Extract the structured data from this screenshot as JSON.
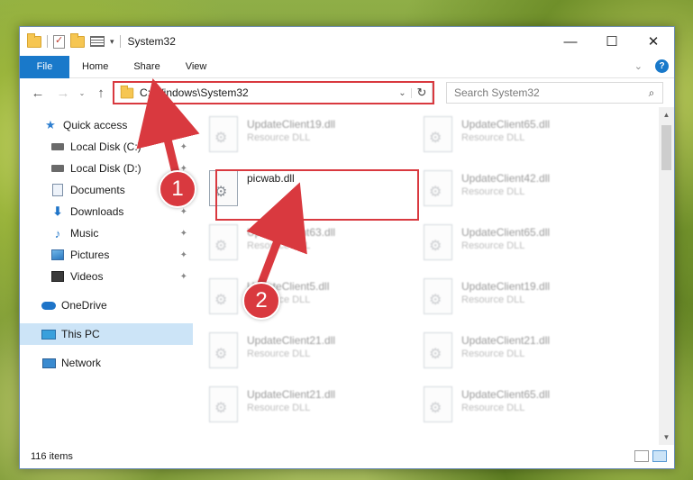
{
  "window": {
    "title": "System32",
    "minimize": "—",
    "maximize": "☐",
    "close": "✕"
  },
  "ribbon": {
    "tabs": [
      "File",
      "Home",
      "Share",
      "View"
    ],
    "collapse": "⌄",
    "help": "?"
  },
  "nav": {
    "back": "←",
    "forward": "→",
    "recent": "⌄",
    "up": "↑",
    "address": "C:\\Windows\\System32",
    "address_dropdown": "⌄",
    "refresh": "↻",
    "search_placeholder": "Search System32",
    "search_icon": "⌕"
  },
  "sidebar": {
    "items": [
      {
        "label": "Quick access",
        "icon": "star-icon",
        "pinned": false
      },
      {
        "label": "Local Disk (C:)",
        "icon": "disk-icon",
        "pinned": true
      },
      {
        "label": "Local Disk (D:)",
        "icon": "disk-icon",
        "pinned": true
      },
      {
        "label": "Documents",
        "icon": "documents-icon",
        "pinned": true
      },
      {
        "label": "Downloads",
        "icon": "downloads-icon",
        "pinned": true
      },
      {
        "label": "Music",
        "icon": "music-icon",
        "pinned": true
      },
      {
        "label": "Pictures",
        "icon": "pictures-icon",
        "pinned": true
      },
      {
        "label": "Videos",
        "icon": "videos-icon",
        "pinned": true
      },
      {
        "label": "OneDrive",
        "icon": "onedrive-icon",
        "pinned": false
      },
      {
        "label": "This PC",
        "icon": "this-pc-icon",
        "pinned": false,
        "selected": true
      },
      {
        "label": "Network",
        "icon": "network-icon",
        "pinned": false
      }
    ],
    "pin_glyph": "📌"
  },
  "files": [
    {
      "name": "UpdateClient19.dll",
      "type": "Resource DLL"
    },
    {
      "name": "UpdateClient65.dll",
      "type": "Resource DLL"
    },
    {
      "name": "picwab.dll",
      "type": "",
      "target": true
    },
    {
      "name": "UpdateClient42.dll",
      "type": "Resource DLL"
    },
    {
      "name": "UpdateClient63.dll",
      "type": "Resource DLL"
    },
    {
      "name": "UpdateClient65.dll",
      "type": "Resource DLL"
    },
    {
      "name": "UpdateClient5.dll",
      "type": "Resource DLL"
    },
    {
      "name": "UpdateClient19.dll",
      "type": "Resource DLL"
    },
    {
      "name": "UpdateClient21.dll",
      "type": "Resource DLL"
    },
    {
      "name": "UpdateClient21.dll",
      "type": "Resource DLL"
    },
    {
      "name": "UpdateClient21.dll",
      "type": "Resource DLL"
    },
    {
      "name": "UpdateClient65.dll",
      "type": "Resource DLL"
    }
  ],
  "status": {
    "item_count": "116 items"
  },
  "annotations": {
    "step1": "1",
    "step2": "2",
    "color": "#d9393f"
  },
  "colors": {
    "accent": "#1979ca",
    "selected": "#cce4f7"
  }
}
